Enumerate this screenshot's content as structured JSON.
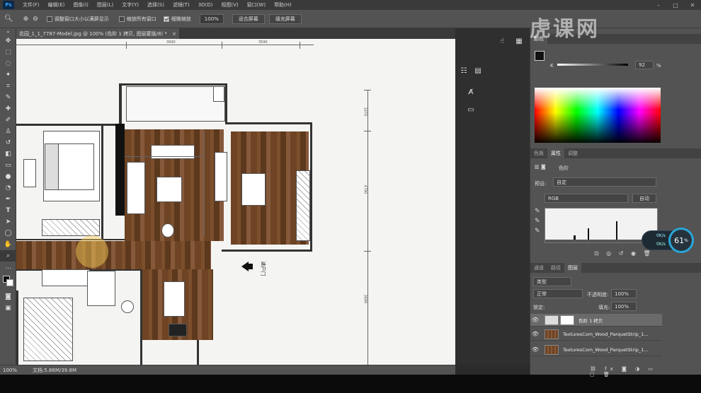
{
  "app": {
    "logo": "Ps"
  },
  "menu": [
    "文件(F)",
    "编辑(E)",
    "图像(I)",
    "图层(L)",
    "文字(Y)",
    "选择(S)",
    "滤镜(T)",
    "3D(D)",
    "视图(V)",
    "窗口(W)",
    "帮助(H)"
  ],
  "window_controls": [
    "–",
    "□",
    "✕"
  ],
  "options": {
    "resize_windows": "调整窗口大小以满屏显示",
    "zoom_all": "缩放所有窗口",
    "scrubby_zoom": "细微缩放",
    "zoom_value": "100%",
    "fit_screen": "适合屏幕",
    "fill_screen": "填充屏幕"
  },
  "document": {
    "tab_title": "花园_1_1_7787-Model.jpg @ 100% (色阶 1 拷贝, 图层蒙版/8) *",
    "close": "×",
    "dims": [
      "3990",
      "3590",
      "1670",
      "4790",
      "3690"
    ],
    "entrance_label": "进户门"
  },
  "status": {
    "zoom": "100%",
    "doc_size": "文档:5.86M/39.8M"
  },
  "watermark": "虎课网",
  "color_panel": {
    "tab": "颜色",
    "channel": "K",
    "value": "92",
    "unit": "%"
  },
  "properties_panel": {
    "tabs": [
      "色板",
      "属性",
      "调整"
    ],
    "title": "色阶",
    "preset_label": "预设:",
    "preset_value": "自定",
    "channel_value": "RGB",
    "auto_button": "自动"
  },
  "layers_panel": {
    "tabs": [
      "通道",
      "路径",
      "图层"
    ],
    "filter_kind": "类型",
    "blend_mode": "正常",
    "opacity_label": "不透明度:",
    "opacity_value": "100%",
    "lock_label": "锁定:",
    "fill_label": "填充:",
    "fill_value": "100%",
    "layers": [
      {
        "name": "色阶 1 拷贝",
        "selected": true
      },
      {
        "name": "TexturesCom_Wood_ParquetStrip_1...",
        "selected": false
      },
      {
        "name": "TexturesCom_Wood_ParquetStrip_1...",
        "selected": false
      }
    ]
  },
  "widget": {
    "gauge": "61",
    "gauge_unit": "%",
    "up": "0K/s",
    "down": "0K/s"
  }
}
